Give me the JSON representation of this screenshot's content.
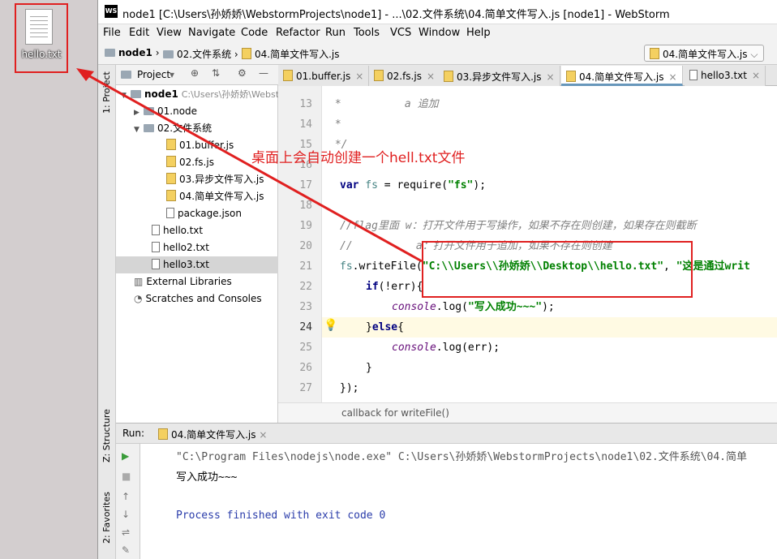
{
  "desktop": {
    "file_label": "hello.txt"
  },
  "window": {
    "logo": "WS",
    "title": "node1 [C:\\Users\\孙娇娇\\WebstormProjects\\node1] - ...\\02.文件系统\\04.简单文件写入.js [node1] - WebStorm"
  },
  "menu": [
    "File",
    "Edit",
    "View",
    "Navigate",
    "Code",
    "Refactor",
    "Run",
    "Tools",
    "VCS",
    "Window",
    "Help"
  ],
  "breadcrumb": [
    "node1",
    "02.文件系统",
    "04.简单文件写入.js"
  ],
  "run_config": "04.简单文件写入.js",
  "left_strip": {
    "project_tab": "1: Project",
    "structure_tab": "Z: Structure",
    "favorites_tab": "2: Favorites"
  },
  "project_panel": {
    "header": "Project",
    "tree": [
      {
        "label": "node1",
        "hint": "C:\\Users\\孙娇娇\\WebstormProjects\\node1",
        "icon": "folder-icon",
        "arrow": "▼"
      },
      {
        "label": "01.node",
        "icon": "folder-icon",
        "arrow": "▶"
      },
      {
        "label": "02.文件系统",
        "icon": "folder-icon",
        "arrow": "▼"
      },
      {
        "label": "01.buffer.js",
        "icon": "js-file-icon"
      },
      {
        "label": "02.fs.js",
        "icon": "js-file-icon"
      },
      {
        "label": "03.异步文件写入.js",
        "icon": "js-file-icon"
      },
      {
        "label": "04.简单文件写入.js",
        "icon": "js-file-icon"
      },
      {
        "label": "package.json",
        "icon": "json-file-icon"
      },
      {
        "label": "hello.txt",
        "icon": "text-file-icon"
      },
      {
        "label": "hello2.txt",
        "icon": "text-file-icon"
      },
      {
        "label": "hello3.txt",
        "icon": "text-file-icon"
      },
      {
        "label": "External Libraries",
        "icon": "library-icon"
      },
      {
        "label": "Scratches and Consoles",
        "icon": "scratch-icon"
      }
    ]
  },
  "tabs": [
    {
      "label": "01.buffer.js"
    },
    {
      "label": "02.fs.js"
    },
    {
      "label": "03.异步文件写入.js"
    },
    {
      "label": "04.简单文件写入.js"
    },
    {
      "label": "hello3.txt"
    }
  ],
  "editor": {
    "line_numbers": [
      "13",
      "14",
      "15",
      "16",
      "17",
      "18",
      "19",
      "20",
      "21",
      "22",
      "23",
      "24",
      "25",
      "26",
      "27"
    ],
    "l13": " *          a 追加",
    "l14": " *",
    "l15": " */",
    "l17_kw": "var",
    "l17_var": " fs",
    "l17_a": " = require(",
    "l17_str": "\"fs\"",
    "l17_b": ");",
    "l19": "//flag里面 w：打开文件用于写操作，如果不存在则创建，如果存在则截断",
    "l20": "//          a：打开文件用于追加，如果不存在则创建",
    "l21_var": "fs",
    "l21_a": ".writeFile(",
    "l21_str": "\"C:\\\\Users\\\\孙娇娇\\\\Desktop\\\\hello.txt\"",
    "l21_b": ", ",
    "l21_str2": "\"这是通过writ",
    "l22_kw": "if",
    "l22_a": "(!err){",
    "l23_fn": "console",
    "l23_a": ".log(",
    "l23_str": "\"写入成功~~~\"",
    "l23_b": ");",
    "l24_a": "}",
    "l24_kw": "else",
    "l24_b": "{",
    "l25_fn": "console",
    "l25_a": ".log(err);",
    "l26": "}",
    "l27": "});",
    "status_hint": "callback for writeFile()"
  },
  "run": {
    "label": "Run:",
    "tab": "04.简单文件写入.js",
    "console_lines": [
      "\"C:\\Program Files\\nodejs\\node.exe\" C:\\Users\\孙娇娇\\WebstormProjects\\node1\\02.文件系统\\04.简单",
      "写入成功~~~",
      "Process finished with exit code 0"
    ]
  },
  "annotation": {
    "text": "桌面上会自动创建一个hell.txt文件",
    "color": "#e02020"
  }
}
